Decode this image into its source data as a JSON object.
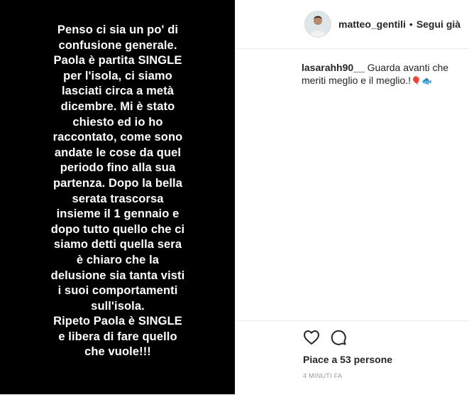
{
  "story": {
    "text": "Penso ci sia un po' di\nconfusione generale.\nPaola è partita SINGLE\nper l'isola, ci siamo\nlasciati circa a metà\ndicembre. Mi è stato\nchiesto ed io ho\nraccontato, come sono\nandate le cose da quel\nperiodo fino alla sua\npartenza. Dopo  la bella\nserata trascorsa\ninsieme il 1 gennaio e\ndopo tutto quello che ci\nsiamo detti quella sera\nè chiaro che la\ndelusione sia tanta visti\ni suoi comportamenti\nsull'isola.\nRipeto Paola è SINGLE\ne libera di fare quello\nche vuole!!!"
  },
  "header": {
    "username": "matteo_gentili",
    "separator": "•",
    "follow_label": "Segui già"
  },
  "comments": [
    {
      "user": "lasarahh90__",
      "text": "Guarda avanti che meriti meglio e il meglio.!",
      "emojis": "🎈🐟"
    }
  ],
  "actions": {
    "likes": "Piace a 53 persone",
    "timestamp": "4 MINUTI FA",
    "icons": [
      "heart-icon",
      "comment-icon"
    ]
  },
  "colors": {
    "media_bg": "#000000",
    "text_primary": "#262626",
    "text_muted": "#999999",
    "border": "#efefef"
  }
}
